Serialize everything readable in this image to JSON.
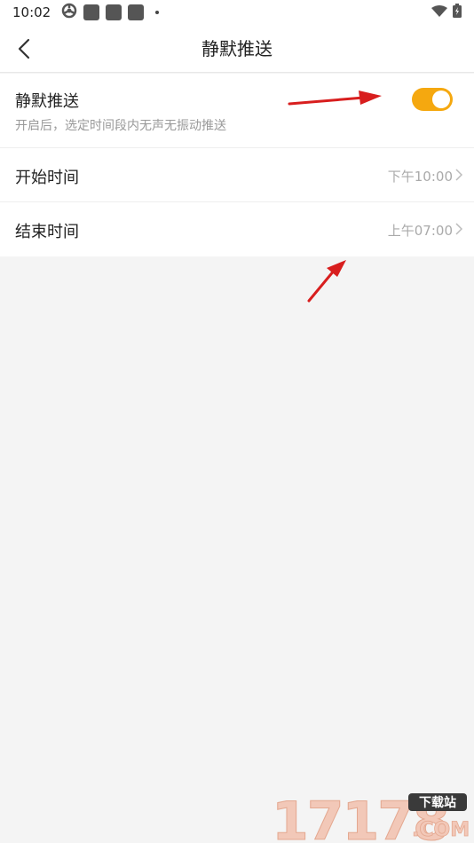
{
  "status_bar": {
    "time": "10:02",
    "icons": [
      "signal-sync-icon",
      "app-icon",
      "app-icon",
      "app-icon",
      "dot-icon",
      "wifi-icon",
      "battery-icon"
    ]
  },
  "nav": {
    "back_icon": "back-arrow-icon",
    "title": "静默推送"
  },
  "settings": {
    "silent_push": {
      "title": "静默推送",
      "description": "开启后，选定时间段内无声无振动推送",
      "enabled": true,
      "toggle_color": "#f5a80f"
    },
    "start_time": {
      "title": "开始时间",
      "value": "下午10:00"
    },
    "end_time": {
      "title": "结束时间",
      "value": "上午07:00"
    }
  },
  "annotations": {
    "arrow_color": "#d81e1e"
  },
  "watermark": {
    "text": "17178",
    "badge": "下载站",
    "suffix": ".COM"
  }
}
